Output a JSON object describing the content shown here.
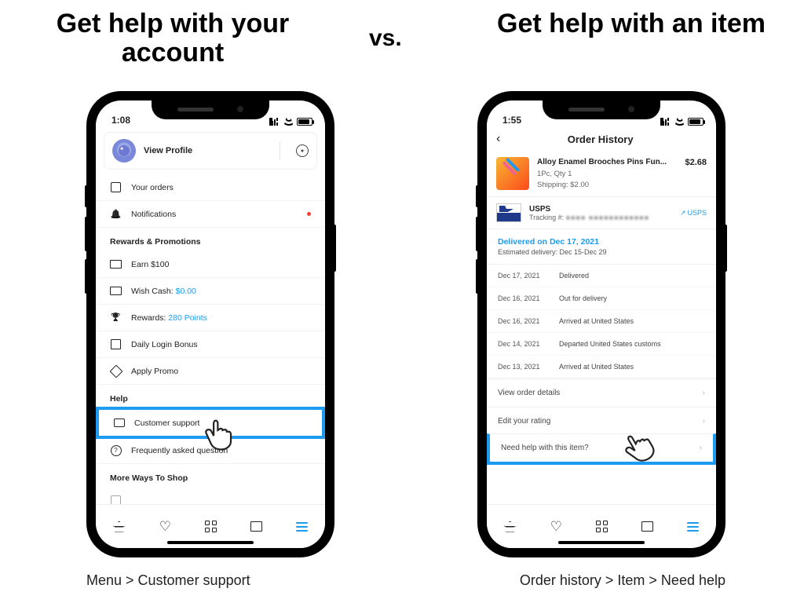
{
  "headings": {
    "left": "Get help with your account",
    "vs": "vs.",
    "right": "Get help with an item"
  },
  "captions": {
    "left": "Menu > Customer support",
    "right": "Order history > Item > Need help"
  },
  "left_phone": {
    "time": "1:08",
    "profile": {
      "view_profile": "View Profile"
    },
    "account": {
      "your_orders": "Your orders",
      "notifications": "Notifications"
    },
    "sections": {
      "rewards_title": "Rewards & Promotions",
      "help_title": "Help",
      "more_title": "More Ways To Shop"
    },
    "rewards": {
      "earn": "Earn $100",
      "wish_cash_label": "Wish Cash: ",
      "wish_cash_value": "$0.00",
      "rewards_label": "Rewards: ",
      "rewards_value": "280 Points",
      "daily_login": "Daily Login Bonus",
      "apply_promo": "Apply Promo"
    },
    "help": {
      "customer_support": "Customer support",
      "faq": "Frequently asked question"
    }
  },
  "right_phone": {
    "time": "1:55",
    "header_title": "Order History",
    "product": {
      "name": "Alloy Enamel Brooches Pins Fun...",
      "price": "$2.68",
      "qty": "1Pc, Qty 1",
      "shipping": "Shipping: $2.00"
    },
    "carrier": {
      "name": "USPS",
      "tracking_label": "Tracking #: ",
      "tracking_masked": "●●●● ●●●●●●●●●●●●",
      "link": "USPS"
    },
    "delivery": {
      "status": "Delivered on Dec 17, 2021",
      "estimate": "Estimated delivery: Dec 15-Dec 29"
    },
    "tracking_events": [
      {
        "date": "Dec 17, 2021",
        "status": "Delivered"
      },
      {
        "date": "Dec 16, 2021",
        "status": "Out for delivery"
      },
      {
        "date": "Dec 16, 2021",
        "status": "Arrived at United States"
      },
      {
        "date": "Dec 14, 2021",
        "status": "Departed United States customs"
      },
      {
        "date": "Dec 13, 2021",
        "status": "Arrived at United States"
      }
    ],
    "actions": {
      "view_details": "View order details",
      "edit_rating": "Edit your rating",
      "need_help": "Need help with this item?"
    }
  }
}
